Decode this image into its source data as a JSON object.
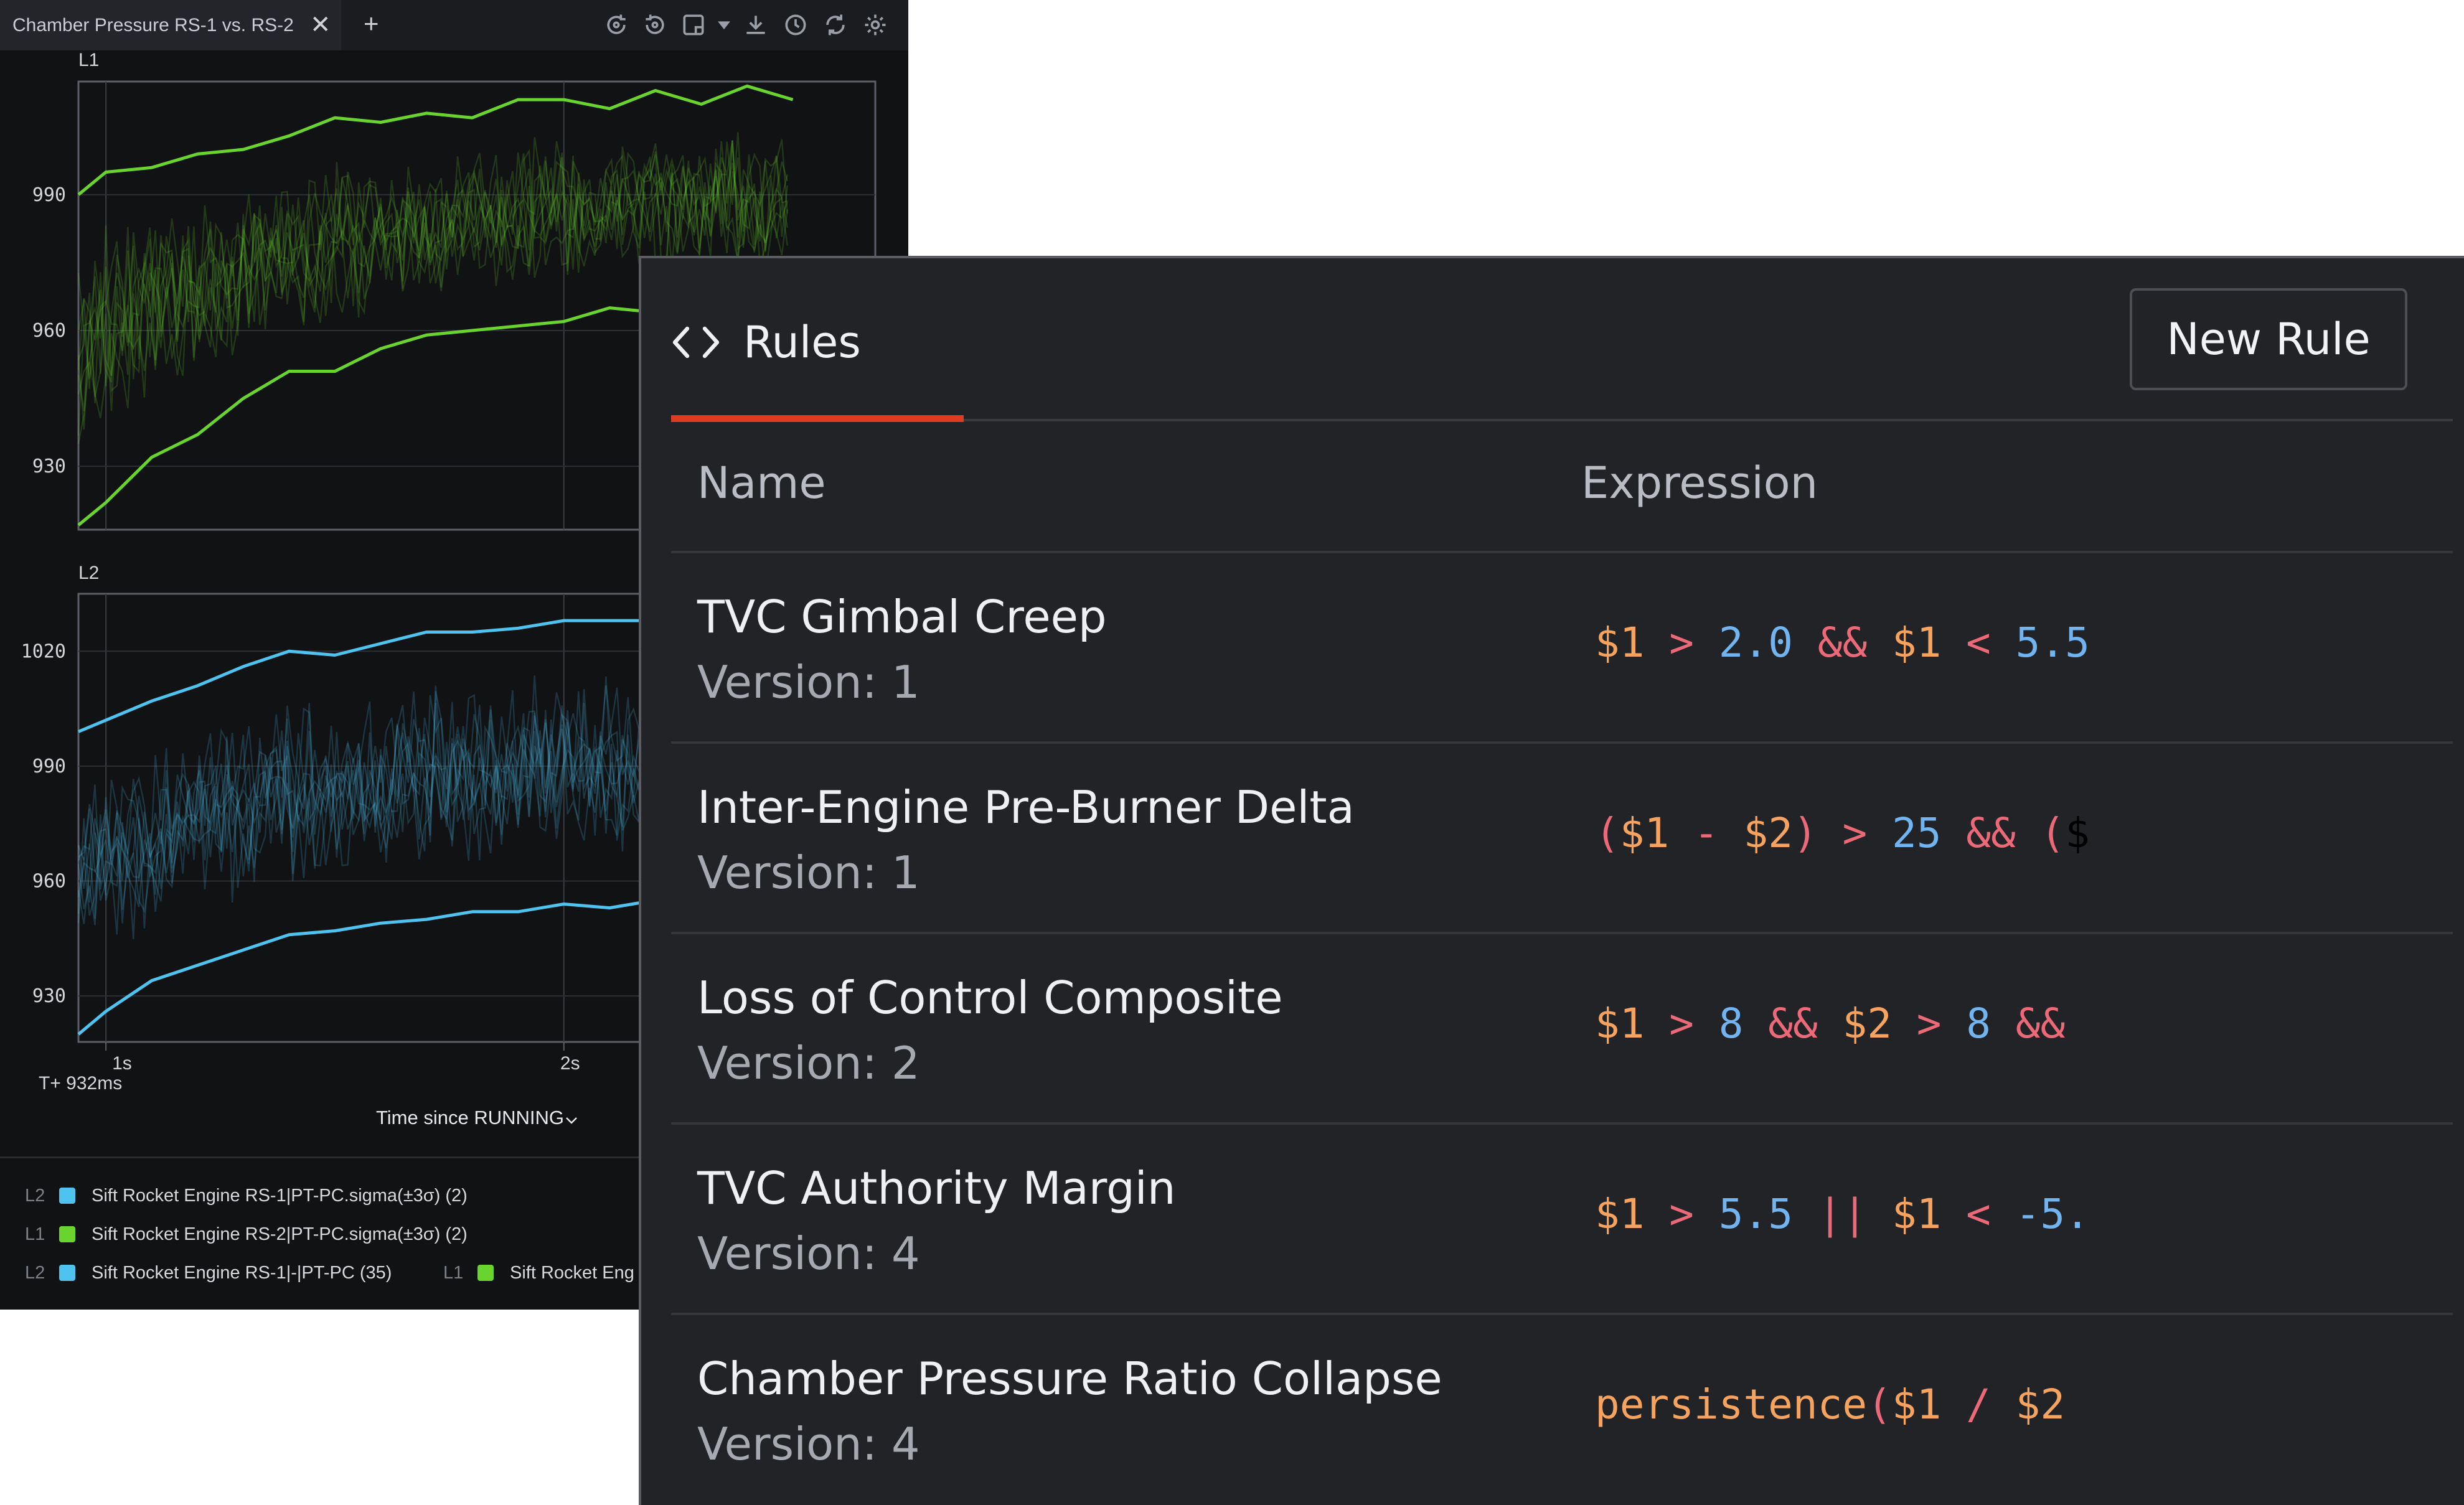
{
  "chart_window": {
    "tab_title": "Chamber Pressure RS-1 vs. RS-2",
    "close_symbol": "✕",
    "add_symbol": "+",
    "toolbar_icons": [
      "undo-zoom-icon",
      "redo-zoom-icon",
      "annotation-icon",
      "chevron-down-icon",
      "download-icon",
      "history-icon",
      "refresh-icon",
      "settings-icon"
    ],
    "legend": [
      {
        "axis": "L2",
        "label": "Sift Rocket Engine RS-1|PT-PC.sigma(±3σ) (2)",
        "color": "#4fc3f0"
      },
      {
        "axis": "L1",
        "label": "Sift Rocket Engine RS-2|PT-PC.sigma(±3σ) (2)",
        "color": "#6ad42e"
      },
      {
        "axis": "L2",
        "label": "Sift Rocket Engine RS-1|-|PT-PC (35)",
        "color": "#4fc3f0"
      },
      {
        "axis": "L1",
        "label": "Sift Rocket Eng",
        "color": "#6ad42e"
      }
    ]
  },
  "chart_data": [
    {
      "type": "line",
      "panel": "L1",
      "color": "#6ad42e",
      "yticks": [
        990,
        960,
        930
      ],
      "ylim": [
        916,
        1015
      ],
      "x": [
        0.94,
        1.0,
        1.1,
        1.2,
        1.3,
        1.4,
        1.5,
        1.6,
        1.7,
        1.8,
        1.9,
        2.0,
        2.1,
        2.2,
        2.3,
        2.4,
        2.5
      ],
      "series": [
        {
          "values": [
            990,
            995,
            996,
            999,
            1000,
            1003,
            1007,
            1006,
            1008,
            1007,
            1011,
            1011,
            1009,
            1013,
            1010,
            1014,
            1011
          ]
        },
        {
          "values": [
            917,
            922,
            932,
            937,
            945,
            951,
            951,
            956,
            959,
            960,
            961,
            962,
            965,
            964,
            965,
            963,
            967
          ]
        }
      ]
    },
    {
      "type": "line",
      "panel": "L2",
      "color": "#4fc3f0",
      "yticks": [
        1020,
        990,
        960,
        930
      ],
      "ylim": [
        918,
        1035
      ],
      "x": [
        0.94,
        1.0,
        1.1,
        1.2,
        1.3,
        1.4,
        1.5,
        1.6,
        1.7,
        1.8,
        1.9,
        2.0,
        2.1,
        2.2,
        2.3,
        2.4,
        2.5
      ],
      "xticks": [
        "1s",
        "2s"
      ],
      "xlabel": "Time since RUNNING",
      "origin_label": "T+ 932ms",
      "series": [
        {
          "values": [
            999,
            1002,
            1007,
            1011,
            1016,
            1020,
            1019,
            1022,
            1025,
            1025,
            1026,
            1028,
            1028,
            1028,
            1030,
            1029,
            1031
          ]
        },
        {
          "values": [
            920,
            926,
            934,
            938,
            942,
            946,
            947,
            949,
            950,
            952,
            952,
            954,
            953,
            955,
            954,
            955,
            955
          ]
        }
      ]
    }
  ],
  "axis_titles": {
    "l1": "L1",
    "l2": "L2"
  },
  "rules_panel": {
    "tab_label": "Rules",
    "new_rule_label": "New Rule",
    "columns": {
      "name": "Name",
      "expression": "Expression"
    },
    "accent_color": "#e03c21",
    "rows": [
      {
        "name": "TVC Gimbal Creep",
        "version": "Version: 1",
        "expression": "$1 > 2.0 && $1 < 5.5"
      },
      {
        "name": "Inter-Engine Pre-Burner Delta",
        "version": "Version: 1",
        "expression": "($1 - $2) > 25 && ($"
      },
      {
        "name": "Loss of Control Composite",
        "version": "Version: 2",
        "expression": "$1 > 8 && $2 > 8 &&"
      },
      {
        "name": "TVC Authority Margin",
        "version": "Version: 4",
        "expression": "$1 > 5.5 || $1 < -5."
      },
      {
        "name": "Chamber Pressure Ratio Collapse",
        "version": "Version: 4",
        "expression": "persistence($1 / $2"
      }
    ]
  }
}
